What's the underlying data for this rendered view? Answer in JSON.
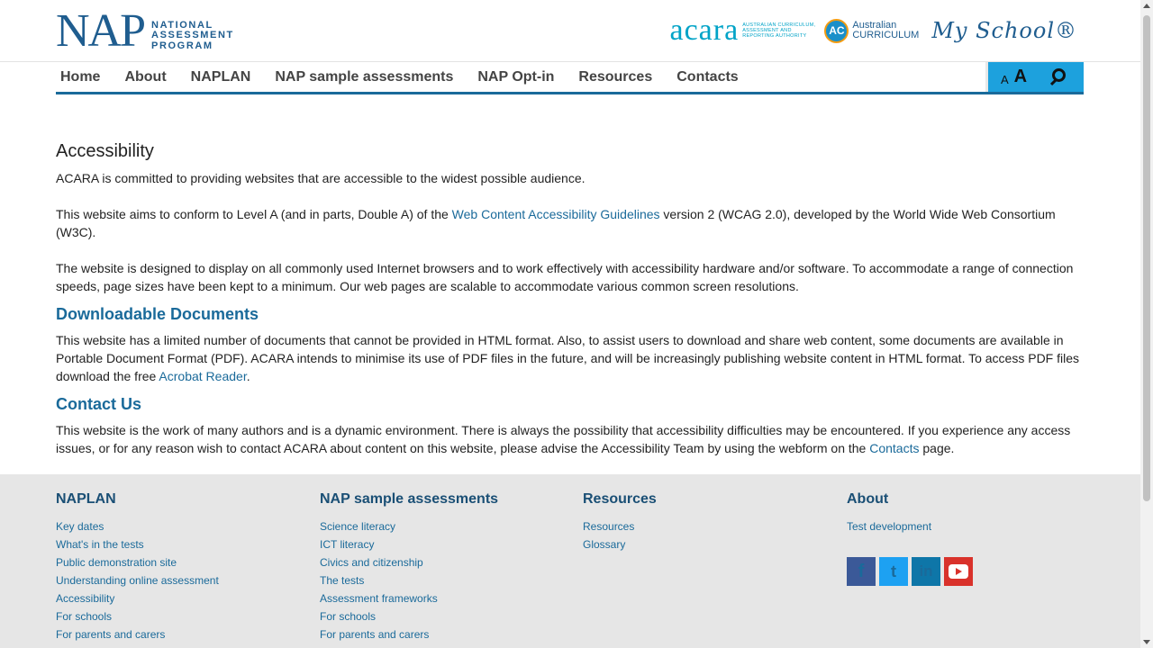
{
  "header": {
    "nap_logo": {
      "big": "NAP",
      "line1": "NATIONAL",
      "line2": "ASSESSMENT",
      "line3": "PROGRAM"
    },
    "acara_logo": {
      "word": "acara",
      "line1": "AUSTRALIAN CURRICULUM,",
      "line2": "ASSESSMENT AND",
      "line3": "REPORTING AUTHORITY"
    },
    "ac_logo": {
      "badge": "AC",
      "line1": "Australian",
      "line2": "CURRICULUM"
    },
    "myschool_logo": "My School®"
  },
  "nav": {
    "items": [
      "Home",
      "About",
      "NAPLAN",
      "NAP sample assessments",
      "NAP Opt-in",
      "Resources",
      "Contacts"
    ],
    "font_small": "A",
    "font_large": "A"
  },
  "main": {
    "title": "Accessibility",
    "p1": "ACARA is committed to providing websites that are accessible to the widest possible audience.",
    "p2_before": "This website aims to conform to Level A (and in parts, Double A) of the ",
    "p2_link": "Web Content Accessibility Guidelines",
    "p2_after": " version 2 (WCAG 2.0), developed by the World Wide Web Consortium (W3C).",
    "p3": "The website is designed to display on all commonly used Internet browsers and to work effectively with accessibility hardware and/or software. To accommodate a range of connection speeds, page sizes have been kept to a minimum. Our web pages are scalable to accommodate various common screen resolutions.",
    "h_docs": "Downloadable Documents",
    "p4_before": "This website has a limited number of documents that cannot be provided in HTML format. Also, to assist users to download and share web content, some documents are available in Portable Document Format (PDF). ACARA intends to minimise its use of PDF files in the future, and will be increasingly publishing website content in HTML format. To access PDF files download the free ",
    "p4_link": "Acrobat Reader",
    "p4_after": ".",
    "h_contact": "Contact Us",
    "p5_before": "This website is the work of many authors and is a dynamic environment. There is always the possibility that accessibility difficulties may be encountered. If you experience any access issues, or for any reason wish to contact ACARA about content on this website, please advise the Accessibility Team by using the webform on the ",
    "p5_link": "Contacts",
    "p5_after": " page."
  },
  "footer": {
    "col1": {
      "title": "NAPLAN",
      "links": [
        "Key dates",
        "What's in the tests",
        "Public demonstration site",
        "Understanding online assessment",
        "Accessibility",
        "For schools",
        "For parents and carers"
      ]
    },
    "col2": {
      "title": "NAP sample assessments",
      "links": [
        "Science literacy",
        "ICT literacy",
        "Civics and citizenship",
        "The tests",
        "Assessment frameworks",
        "For schools",
        "For parents and carers"
      ]
    },
    "col3": {
      "title": "Resources",
      "links": [
        "Resources",
        "Glossary"
      ]
    },
    "col4": {
      "title": "About",
      "links": [
        "Test development"
      ]
    },
    "social": {
      "facebook": "f",
      "twitter": "t",
      "linkedin": "in"
    }
  },
  "colors": {
    "brand_blue": "#1a6a9a",
    "nav_tools": "#1da1dd",
    "footer_bg": "#e6e6e6"
  }
}
